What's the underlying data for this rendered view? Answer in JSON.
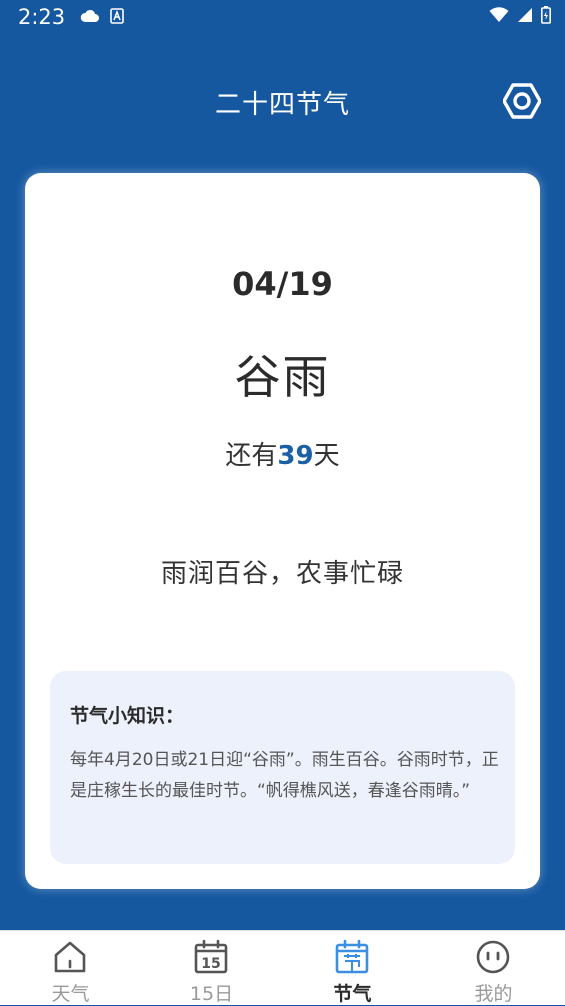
{
  "status_bar": {
    "time": "2:23",
    "left_icons": [
      "cloud-icon",
      "a-box-icon"
    ],
    "right_icons": [
      "wifi-icon",
      "signal-icon",
      "battery-icon"
    ]
  },
  "header": {
    "title": "二十四节气",
    "settings_icon": "hexagon-settings-icon"
  },
  "term_card": {
    "date": "04/19",
    "name": "谷雨",
    "countdown_prefix": "还有",
    "countdown_days": "39",
    "countdown_suffix": "天",
    "proverb": "雨润百谷，农事忙碌",
    "knowledge": {
      "title": "节气小知识：",
      "body": "每年4月20日或21日迎“谷雨”。雨生百谷。谷雨时节，正是庄稼生长的最佳时节。“帆得樵风送，春逢谷雨晴。”"
    }
  },
  "bottom_nav": {
    "items": [
      {
        "label": "天气",
        "icon": "home-icon",
        "active": false
      },
      {
        "label": "15日",
        "icon": "calendar-15-icon",
        "active": false
      },
      {
        "label": "节气",
        "icon": "calendar-jieqi-icon",
        "active": true
      },
      {
        "label": "我的",
        "icon": "face-icon",
        "active": false
      }
    ]
  },
  "colors": {
    "background": "#1558a0",
    "accent": "#1b5fa5",
    "active_nav": "#3a8fe0",
    "inactive_nav": "#9a9a9a",
    "knowledge_bg": "#edf1fb"
  }
}
